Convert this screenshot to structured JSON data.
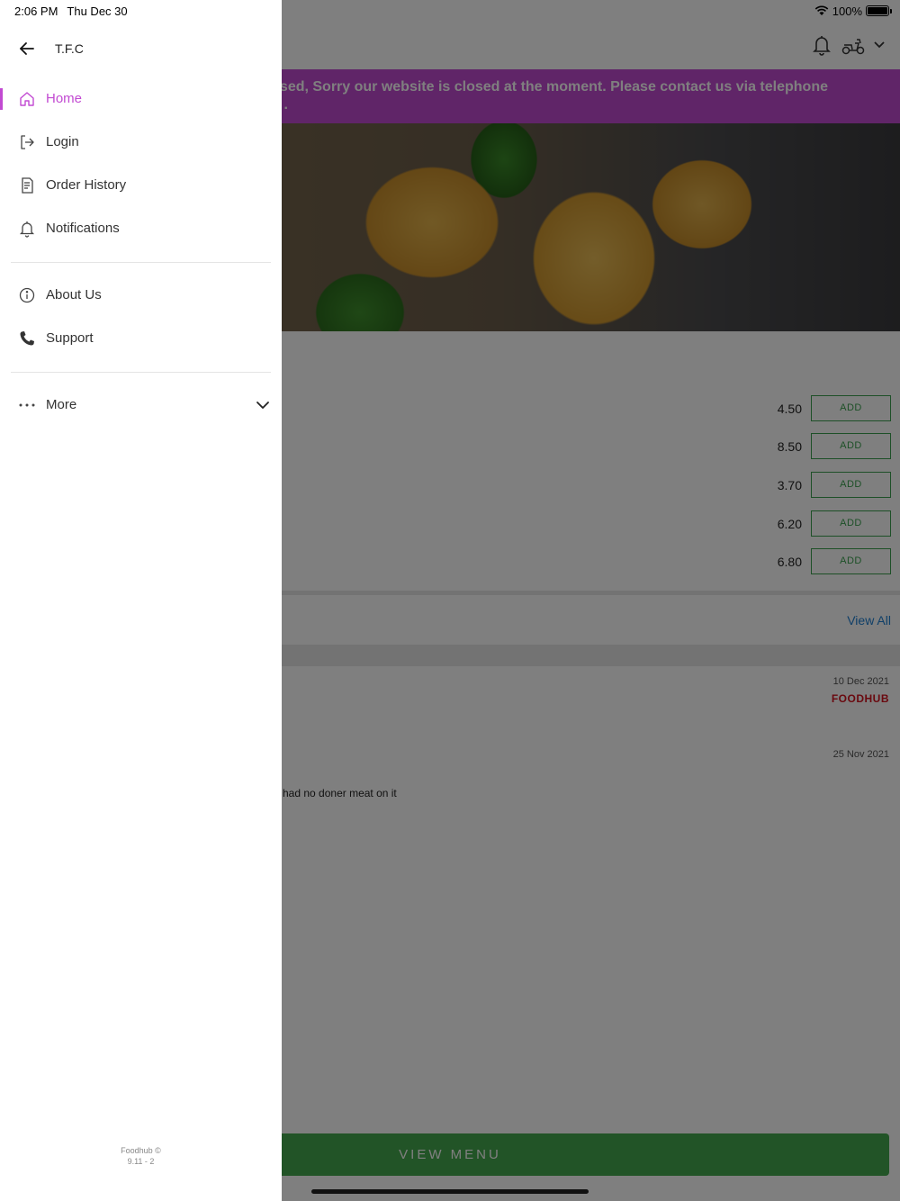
{
  "status_bar": {
    "time": "2:06 PM",
    "date": "Thu Dec 30",
    "battery": "100%"
  },
  "drawer": {
    "title": "T.F.C",
    "nav_primary": [
      {
        "label": "Home",
        "icon": "home-icon",
        "active": true
      },
      {
        "label": "Login",
        "icon": "login-icon"
      },
      {
        "label": "Order History",
        "icon": "receipt-icon"
      },
      {
        "label": "Notifications",
        "icon": "bell-icon"
      }
    ],
    "nav_secondary": [
      {
        "label": "About Us",
        "icon": "info-icon"
      },
      {
        "label": "Support",
        "icon": "phone-icon"
      }
    ],
    "more_label": "More",
    "footer_line1": "Foodhub ©",
    "footer_line2": "9.11 - 2"
  },
  "background": {
    "banner_line1": "osed, Sorry our website is closed at the moment. Please contact us via telephone",
    "banner_line2": ".",
    "items": [
      {
        "price": "4.50",
        "add_label": "ADD"
      },
      {
        "price": "8.50",
        "add_label": "ADD"
      },
      {
        "price": "3.70",
        "add_label": "ADD"
      },
      {
        "price": "6.20",
        "add_label": "ADD"
      },
      {
        "price": "6.80",
        "add_label": "ADD"
      }
    ],
    "view_all": "View All",
    "reviews": [
      {
        "date": "10 Dec 2021",
        "source": "FOODHUB"
      },
      {
        "date": "25 Nov 2021",
        "text": "er had no doner meat on it"
      }
    ],
    "view_menu": "VIEW MENU"
  },
  "colors": {
    "accent": "#c24ad2",
    "banner": "#c04ad0",
    "add_green": "#3aa14e",
    "view_menu_green": "#45a84f",
    "link_blue": "#1f7fd1",
    "foodhub_red": "#d4121f"
  }
}
